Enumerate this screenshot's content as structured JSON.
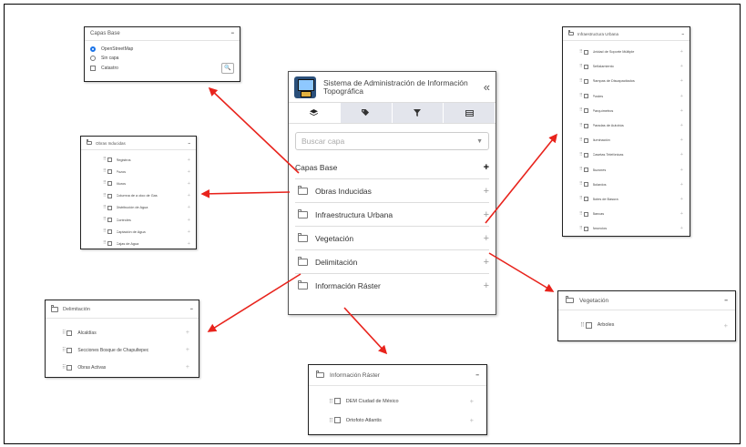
{
  "main_panel": {
    "title_line1": "Sistema de Administración de Información",
    "title_line2": "Topográfica",
    "collapse_icon": "«",
    "tabs": [
      "layers-icon",
      "tags-icon",
      "filter-icon",
      "table-icon"
    ],
    "search_placeholder": "Buscar capa",
    "groups": [
      {
        "label": "Capas Base",
        "icon": "+"
      },
      {
        "label": "Obras Inducidas",
        "icon": "+"
      },
      {
        "label": "Infraestructura Urbana",
        "icon": "+"
      },
      {
        "label": "Vegetación",
        "icon": "+"
      },
      {
        "label": "Delimitación",
        "icon": "+"
      },
      {
        "label": "Información Ráster",
        "icon": "+"
      }
    ]
  },
  "capas_base": {
    "title": "Capas Base",
    "minus": "−",
    "options": [
      {
        "label": "OpenStreetMap",
        "type": "radio",
        "selected": true
      },
      {
        "label": "Sin capa",
        "type": "radio",
        "selected": false
      },
      {
        "label": "Catastro",
        "type": "checkbox",
        "selected": false
      }
    ],
    "search_icon": "🔍"
  },
  "obras_inducidas": {
    "title": "Obras Inducidas",
    "minus": "−",
    "items": [
      "Registros",
      "Pozos",
      "Muros",
      "Columna de a oloo de Gas",
      "Distribución de Agua",
      "Controles",
      "Captación de Agua",
      "Cajas de Agua"
    ]
  },
  "infraestructura_urbana": {
    "title": "Infraestructura Urbana",
    "minus": "−",
    "items": [
      "Unidad de Soporte Múltiple",
      "Señalamiento",
      "Rampas de Discapacitados",
      "Postes",
      "Parquímetros",
      "Paradas de Autobús",
      "Iluminación",
      "Casetas Telefónicas",
      "Buzones",
      "Bolardos",
      "Botes de Basura",
      "Bancas",
      "Anuncios"
    ]
  },
  "vegetacion": {
    "title": "Vegetación",
    "minus": "−",
    "items": [
      "Árboles"
    ]
  },
  "delimitacion": {
    "title": "Delimitación",
    "minus": "−",
    "items": [
      "Alcaldías",
      "Secciones Bosque de Chapultepec",
      "Obras Activas"
    ]
  },
  "informacion_raster": {
    "title": "Información Ráster",
    "minus": "−",
    "items": [
      "DEM Ciudad de México",
      "Ortofoto Atlantis"
    ]
  },
  "plus_icon": "+",
  "grip_icon": "⠿",
  "arrow_color": "#e8231c"
}
